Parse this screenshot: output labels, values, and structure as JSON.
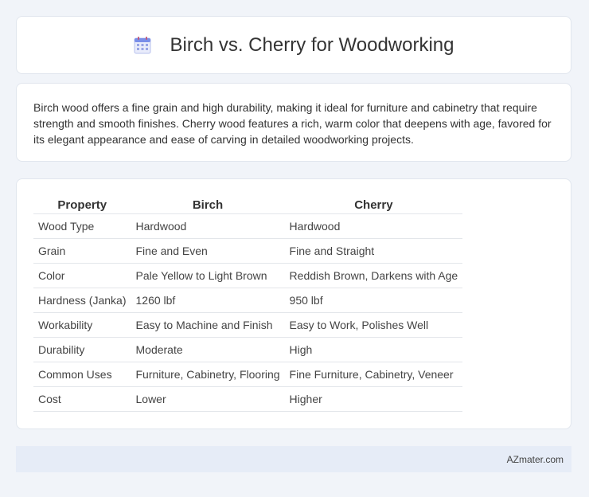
{
  "header": {
    "icon": "calendar-icon",
    "title": "Birch vs. Cherry for Woodworking"
  },
  "description": "Birch wood offers a fine grain and high durability, making it ideal for furniture and cabinetry that require strength and smooth finishes. Cherry wood features a rich, warm color that deepens with age, favored for its elegant appearance and ease of carving in detailed woodworking projects.",
  "table": {
    "headers": [
      "Property",
      "Birch",
      "Cherry"
    ],
    "rows": [
      [
        "Wood Type",
        "Hardwood",
        "Hardwood"
      ],
      [
        "Grain",
        "Fine and Even",
        "Fine and Straight"
      ],
      [
        "Color",
        "Pale Yellow to Light Brown",
        "Reddish Brown, Darkens with Age"
      ],
      [
        "Hardness (Janka)",
        "1260 lbf",
        "950 lbf"
      ],
      [
        "Workability",
        "Easy to Machine and Finish",
        "Easy to Work, Polishes Well"
      ],
      [
        "Durability",
        "Moderate",
        "High"
      ],
      [
        "Common Uses",
        "Furniture, Cabinetry, Flooring",
        "Fine Furniture, Cabinetry, Veneer"
      ],
      [
        "Cost",
        "Lower",
        "Higher"
      ]
    ]
  },
  "footer": {
    "brand": "AZmater.com"
  },
  "colors": {
    "background": "#f1f4f9",
    "card": "#ffffff",
    "footer_bg": "#e6ecf7",
    "icon_accent": "#7a8ee8"
  }
}
